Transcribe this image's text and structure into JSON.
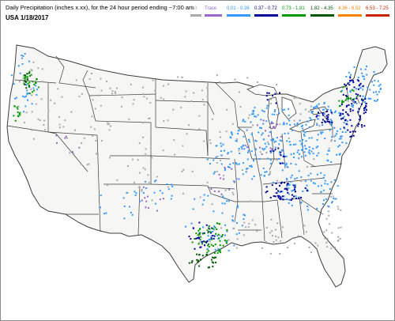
{
  "header": {
    "title": "Daily Precipitation (inches  x.xx),  for the 24 hour period ending ~7:00 am",
    "date": "USA 1/18/2017"
  },
  "legend": [
    {
      "label": "0.0",
      "color": "#a9a9a9"
    },
    {
      "label": "Trace",
      "color": "#9966cc"
    },
    {
      "label": "0.01 - 0.36",
      "color": "#3399ff"
    },
    {
      "label": "0.37 - 0.72",
      "color": "#000099"
    },
    {
      "label": "0.73 - 1.81",
      "color": "#009900"
    },
    {
      "label": "1.82 - 4.35",
      "color": "#005500"
    },
    {
      "label": "4.36 - 6.52",
      "color": "#ff8000"
    },
    {
      "label": "6.53 - 7.25",
      "color": "#cc2200"
    }
  ],
  "colors": {
    "land": "#f6f6f4",
    "border": "#3c3c3c",
    "water": "#ffffff"
  }
}
